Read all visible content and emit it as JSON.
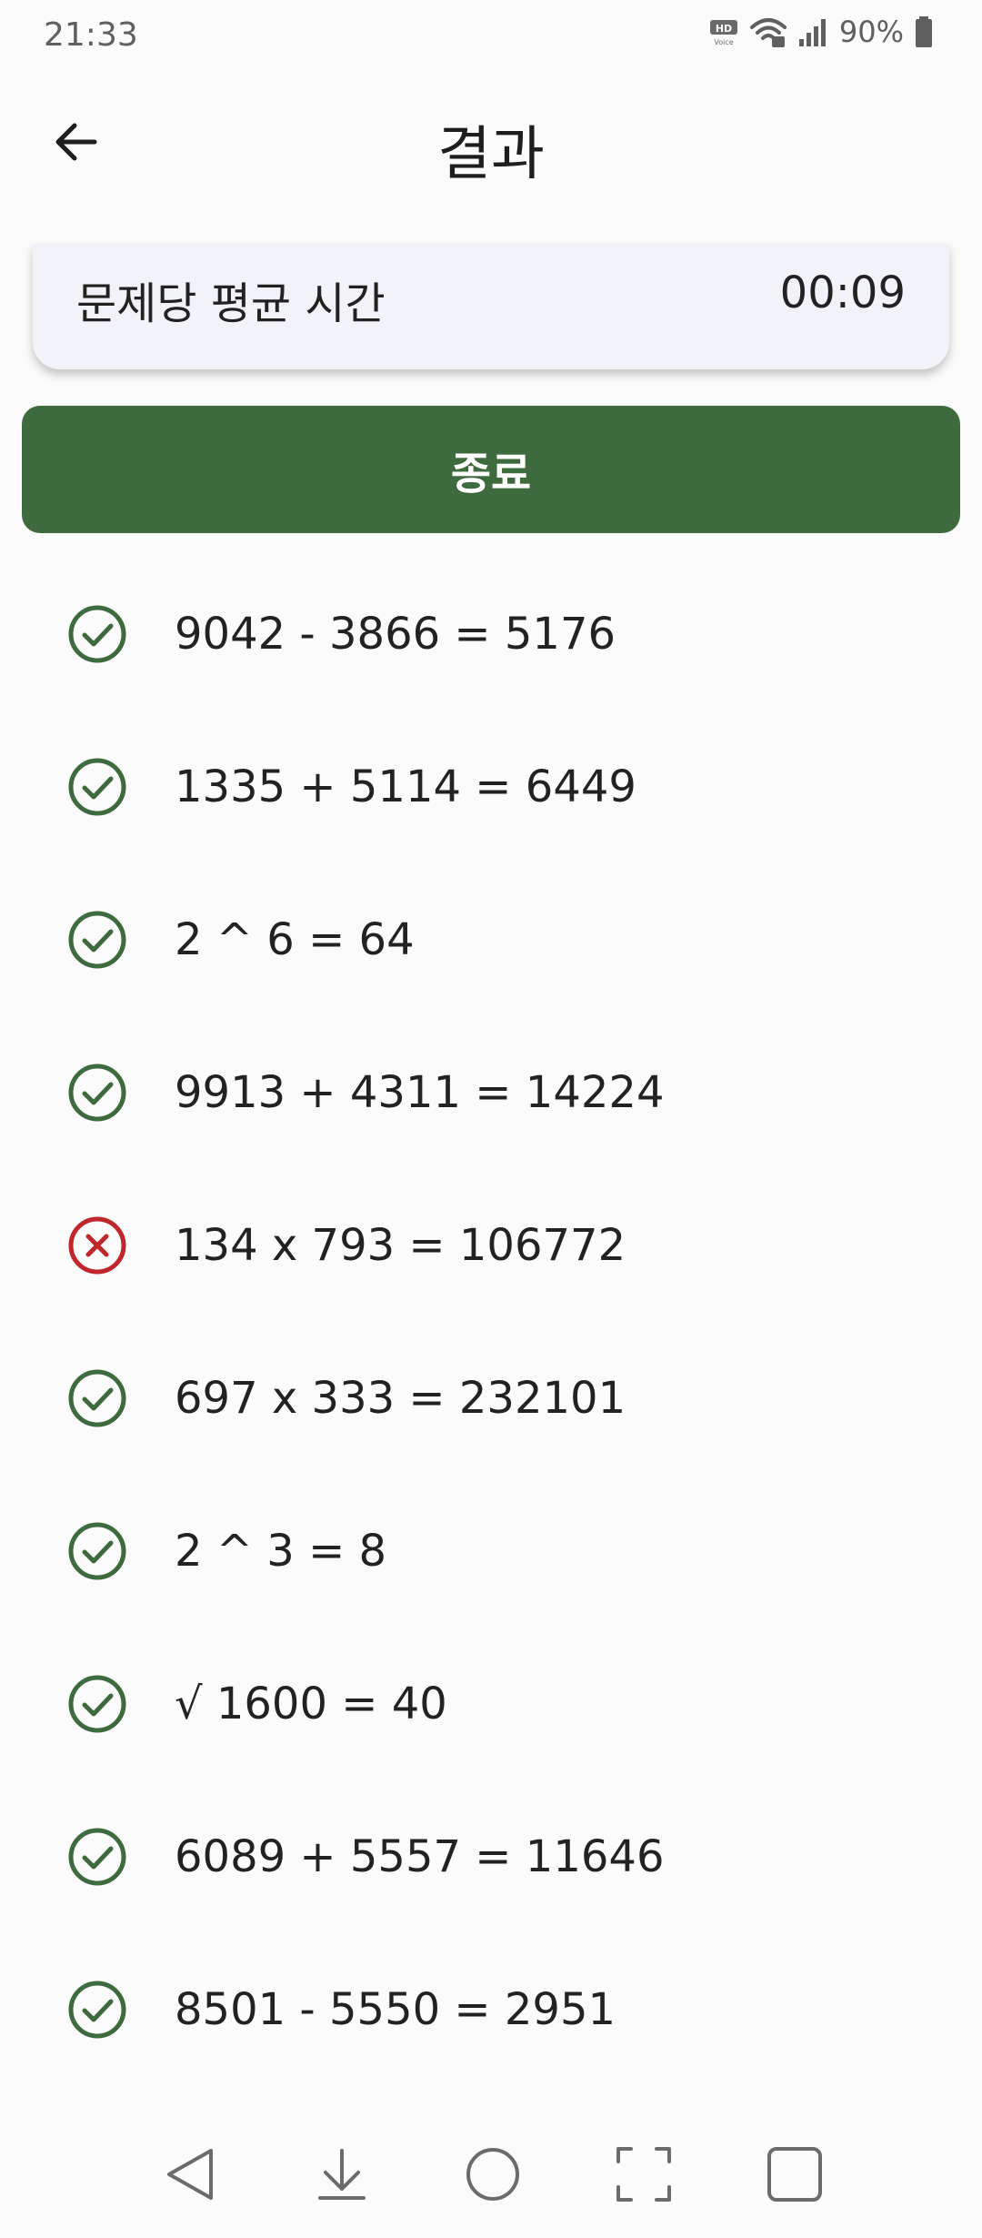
{
  "status_bar": {
    "time": "21:33",
    "battery": "90%",
    "icons": [
      "hd-voice-icon",
      "wifi-icon",
      "signal-icon",
      "battery-icon"
    ]
  },
  "header": {
    "title": "결과",
    "back_icon": "arrow-left-icon"
  },
  "summary": {
    "avg_time_label": "문제당 평균 시간",
    "avg_time_value": "00:09"
  },
  "finish_button": {
    "label": "종료"
  },
  "results": [
    {
      "expression": "9042 - 3866 = 5176",
      "status": "correct"
    },
    {
      "expression": "1335 + 5114 = 6449",
      "status": "correct"
    },
    {
      "expression": "2 ^ 6 = 64",
      "status": "correct"
    },
    {
      "expression": "9913 + 4311 = 14224",
      "status": "correct"
    },
    {
      "expression": "134 x 793 = 106772",
      "status": "incorrect"
    },
    {
      "expression": "697 x 333 = 232101",
      "status": "correct"
    },
    {
      "expression": "2 ^ 3 = 8",
      "status": "correct"
    },
    {
      "expression": "√ 1600 = 40",
      "status": "correct"
    },
    {
      "expression": "6089 + 5557 = 11646",
      "status": "correct"
    },
    {
      "expression": "8501 - 5550 = 2951",
      "status": "correct"
    }
  ],
  "colors": {
    "accent": "#3e6b3d",
    "correct": "#3e6b3d",
    "incorrect": "#c0272d",
    "card_bg": "#f2f3f8",
    "background": "#fbfbfb"
  },
  "nav_bar": {
    "icons": [
      "nav-back-icon",
      "nav-notification-icon",
      "nav-home-icon",
      "nav-screenshot-icon",
      "nav-recents-icon"
    ]
  }
}
